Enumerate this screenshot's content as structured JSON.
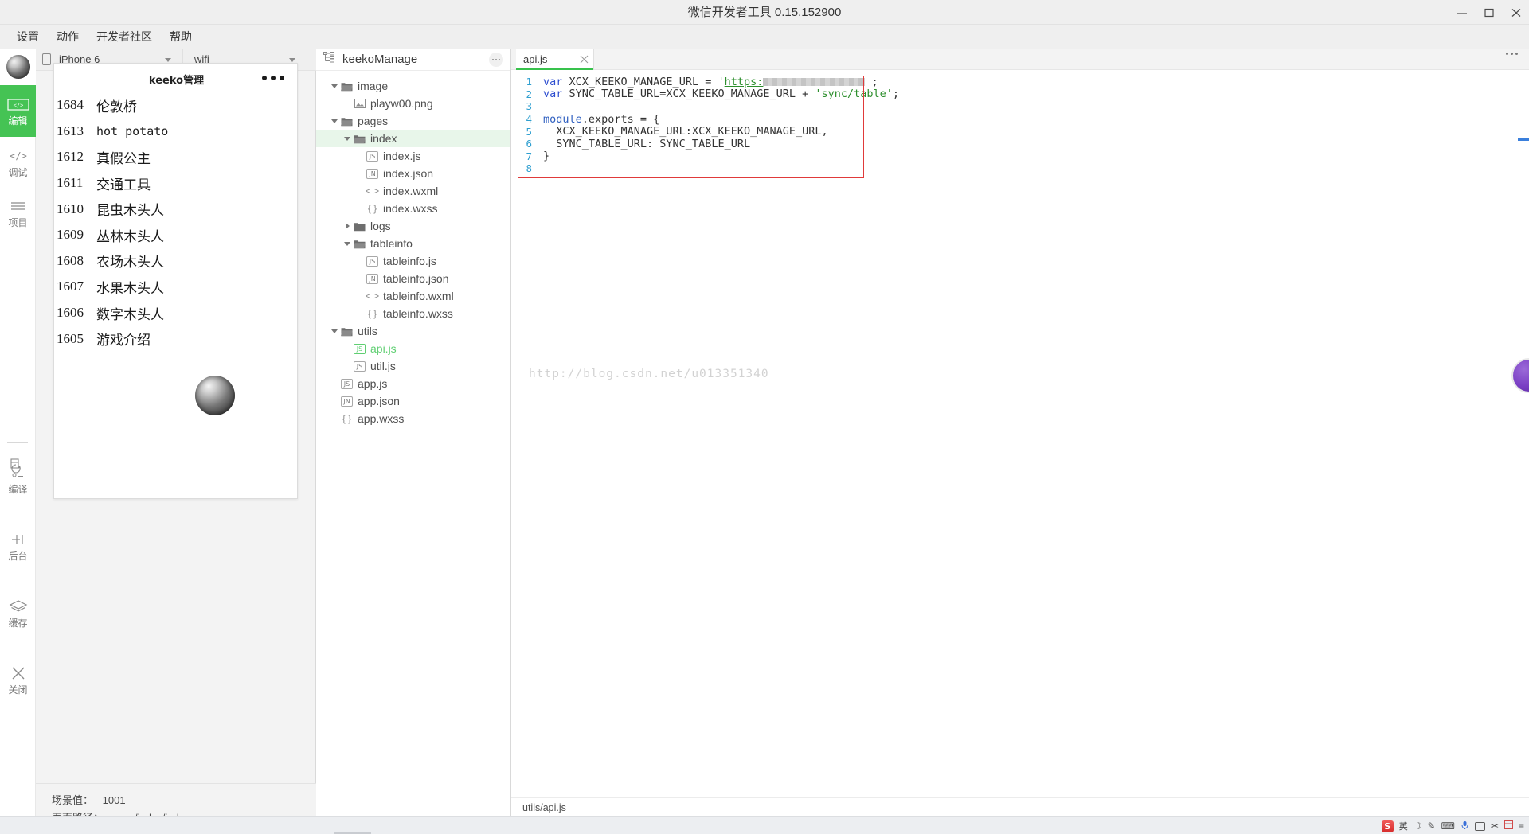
{
  "window": {
    "title": "微信开发者工具 0.15.152900",
    "controls": [
      {
        "name": "minimize",
        "glyph": "minimize-icon"
      },
      {
        "name": "maximize",
        "glyph": "maximize-icon"
      },
      {
        "name": "close",
        "glyph": "close-icon"
      }
    ]
  },
  "menubar": {
    "items": [
      {
        "label": "设置"
      },
      {
        "label": "动作"
      },
      {
        "label": "开发者社区"
      },
      {
        "label": "帮助"
      }
    ]
  },
  "rail": {
    "avatar_name": "user-avatar",
    "active_color": "#45c354",
    "items": [
      {
        "id": "edit",
        "label": "编辑",
        "icon": "code-brackets-icon",
        "active": true
      },
      {
        "id": "debug",
        "label": "调试",
        "icon": "code-slash-icon",
        "active": false
      },
      {
        "id": "project",
        "label": "项目",
        "icon": "lines-icon",
        "active": false
      },
      {
        "id": "compile",
        "label": "编译",
        "icon": "compile-icon",
        "active": false
      },
      {
        "id": "backend",
        "label": "后台",
        "icon": "background-icon",
        "active": false
      },
      {
        "id": "cache",
        "label": "缓存",
        "icon": "layers-icon",
        "active": false
      },
      {
        "id": "close",
        "label": "关闭",
        "icon": "close-x-icon",
        "active": false
      }
    ]
  },
  "simulator": {
    "device": "iPhone 6",
    "network": "wifi",
    "phone": {
      "title": "keeko管理",
      "menu_icon": "three-dots-icon",
      "rows": [
        {
          "id": "1684",
          "name": "伦敦桥"
        },
        {
          "id": "1613",
          "name": "hot potato"
        },
        {
          "id": "1612",
          "name": "真假公主"
        },
        {
          "id": "1611",
          "name": "交通工具"
        },
        {
          "id": "1610",
          "name": "昆虫木头人"
        },
        {
          "id": "1609",
          "name": "丛林木头人"
        },
        {
          "id": "1608",
          "name": "农场木头人"
        },
        {
          "id": "1607",
          "name": "水果木头人"
        },
        {
          "id": "1606",
          "name": "数字木头人"
        },
        {
          "id": "1605",
          "name": "游戏介绍"
        }
      ]
    },
    "footer": {
      "scene_label": "场景值：",
      "scene_value": "1001",
      "path_label": "页面路径：",
      "path_value": "pages/index/index"
    }
  },
  "tree": {
    "project_name": "keekoManage",
    "project_icon": "sitemap-icon",
    "more_icon": "ellipsis-icon",
    "nodes": [
      {
        "label": "image",
        "type": "folder",
        "depth": 1,
        "state": "open",
        "icon": "folder-open-icon"
      },
      {
        "label": "playw00.png",
        "type": "file",
        "depth": 2,
        "icon": "image-file-icon",
        "badge": "IMG"
      },
      {
        "label": "pages",
        "type": "folder",
        "depth": 1,
        "state": "open",
        "icon": "folder-open-icon"
      },
      {
        "label": "index",
        "type": "folder",
        "depth": 2,
        "state": "open",
        "icon": "folder-open-icon",
        "selected": true
      },
      {
        "label": "index.js",
        "type": "file",
        "depth": 3,
        "icon": "js-file-icon",
        "badge": "JS"
      },
      {
        "label": "index.json",
        "type": "file",
        "depth": 3,
        "icon": "json-file-icon",
        "badge": "JN"
      },
      {
        "label": "index.wxml",
        "type": "file",
        "depth": 3,
        "icon": "wxml-file-icon",
        "badge": "< >"
      },
      {
        "label": "index.wxss",
        "type": "file",
        "depth": 3,
        "icon": "wxss-file-icon",
        "badge": "{ }"
      },
      {
        "label": "logs",
        "type": "folder",
        "depth": 2,
        "state": "closed",
        "icon": "folder-closed-icon"
      },
      {
        "label": "tableinfo",
        "type": "folder",
        "depth": 2,
        "state": "open",
        "icon": "folder-open-icon"
      },
      {
        "label": "tableinfo.js",
        "type": "file",
        "depth": 3,
        "icon": "js-file-icon",
        "badge": "JS"
      },
      {
        "label": "tableinfo.json",
        "type": "file",
        "depth": 3,
        "icon": "json-file-icon",
        "badge": "JN"
      },
      {
        "label": "tableinfo.wxml",
        "type": "file",
        "depth": 3,
        "icon": "wxml-file-icon",
        "badge": "< >"
      },
      {
        "label": "tableinfo.wxss",
        "type": "file",
        "depth": 3,
        "icon": "wxss-file-icon",
        "badge": "{ }"
      },
      {
        "label": "utils",
        "type": "folder",
        "depth": 1,
        "state": "open",
        "icon": "folder-open-icon"
      },
      {
        "label": "api.js",
        "type": "file",
        "depth": 2,
        "icon": "js-file-icon",
        "badge": "JS",
        "active": true
      },
      {
        "label": "util.js",
        "type": "file",
        "depth": 2,
        "icon": "js-file-icon",
        "badge": "JS"
      },
      {
        "label": "app.js",
        "type": "file",
        "depth": 1,
        "icon": "js-file-icon",
        "badge": "JS"
      },
      {
        "label": "app.json",
        "type": "file",
        "depth": 1,
        "icon": "json-file-icon",
        "badge": "JN"
      },
      {
        "label": "app.wxss",
        "type": "file",
        "depth": 1,
        "icon": "wxss-file-icon",
        "badge": "{ }"
      }
    ]
  },
  "editor": {
    "tab": {
      "label": "api.js",
      "close_icon": "close-icon"
    },
    "more_icon": "ellipsis-icon",
    "accent": "#38c24c",
    "highlight_border": "#e03a3a",
    "watermark": "http://blog.csdn.net/u013351340",
    "lines": [
      {
        "n": "1"
      },
      {
        "n": "2"
      },
      {
        "n": "3"
      },
      {
        "n": "4"
      },
      {
        "n": "5"
      },
      {
        "n": "6"
      },
      {
        "n": "7"
      },
      {
        "n": "8"
      }
    ],
    "code": {
      "l1_kw": "var",
      "l1_mid": " XCX_KEEKO_MANAGE_URL = ",
      "l1_quote": "'",
      "l1_link": "https:",
      "l1_end": " ;",
      "l2_kw": "var",
      "l2_mid": " SYNC_TABLE_URL=XCX_KEEKO_MANAGE_URL + ",
      "l2_str": "'sync/table'",
      "l2_end": ";",
      "l4_a": "module",
      "l4_b": ".exports = {",
      "l5": "  XCX_KEEKO_MANAGE_URL:XCX_KEEKO_MANAGE_URL,",
      "l6": "  SYNC_TABLE_URL: SYNC_TABLE_URL",
      "l7": "}"
    }
  },
  "statusbar": {
    "path": "utils/api.js"
  },
  "taskbar": {
    "tray": [
      {
        "name": "sogou-input-logo",
        "label": "S"
      },
      {
        "name": "ime-lang-indicator",
        "label": "英"
      },
      {
        "name": "ime-moon-icon",
        "label": "☽"
      },
      {
        "name": "ime-emoji-icon",
        "label": "✎"
      },
      {
        "name": "ime-toolbox-icon",
        "label": "⌨"
      },
      {
        "name": "ime-mic-icon",
        "label": "🎤"
      },
      {
        "name": "ime-keyboard-icon",
        "label": "▭"
      },
      {
        "name": "ime-screenshot-icon",
        "label": "✂"
      },
      {
        "name": "ime-menu-icon",
        "label": "▦"
      },
      {
        "name": "ime-settings-icon",
        "label": "≡"
      }
    ]
  }
}
